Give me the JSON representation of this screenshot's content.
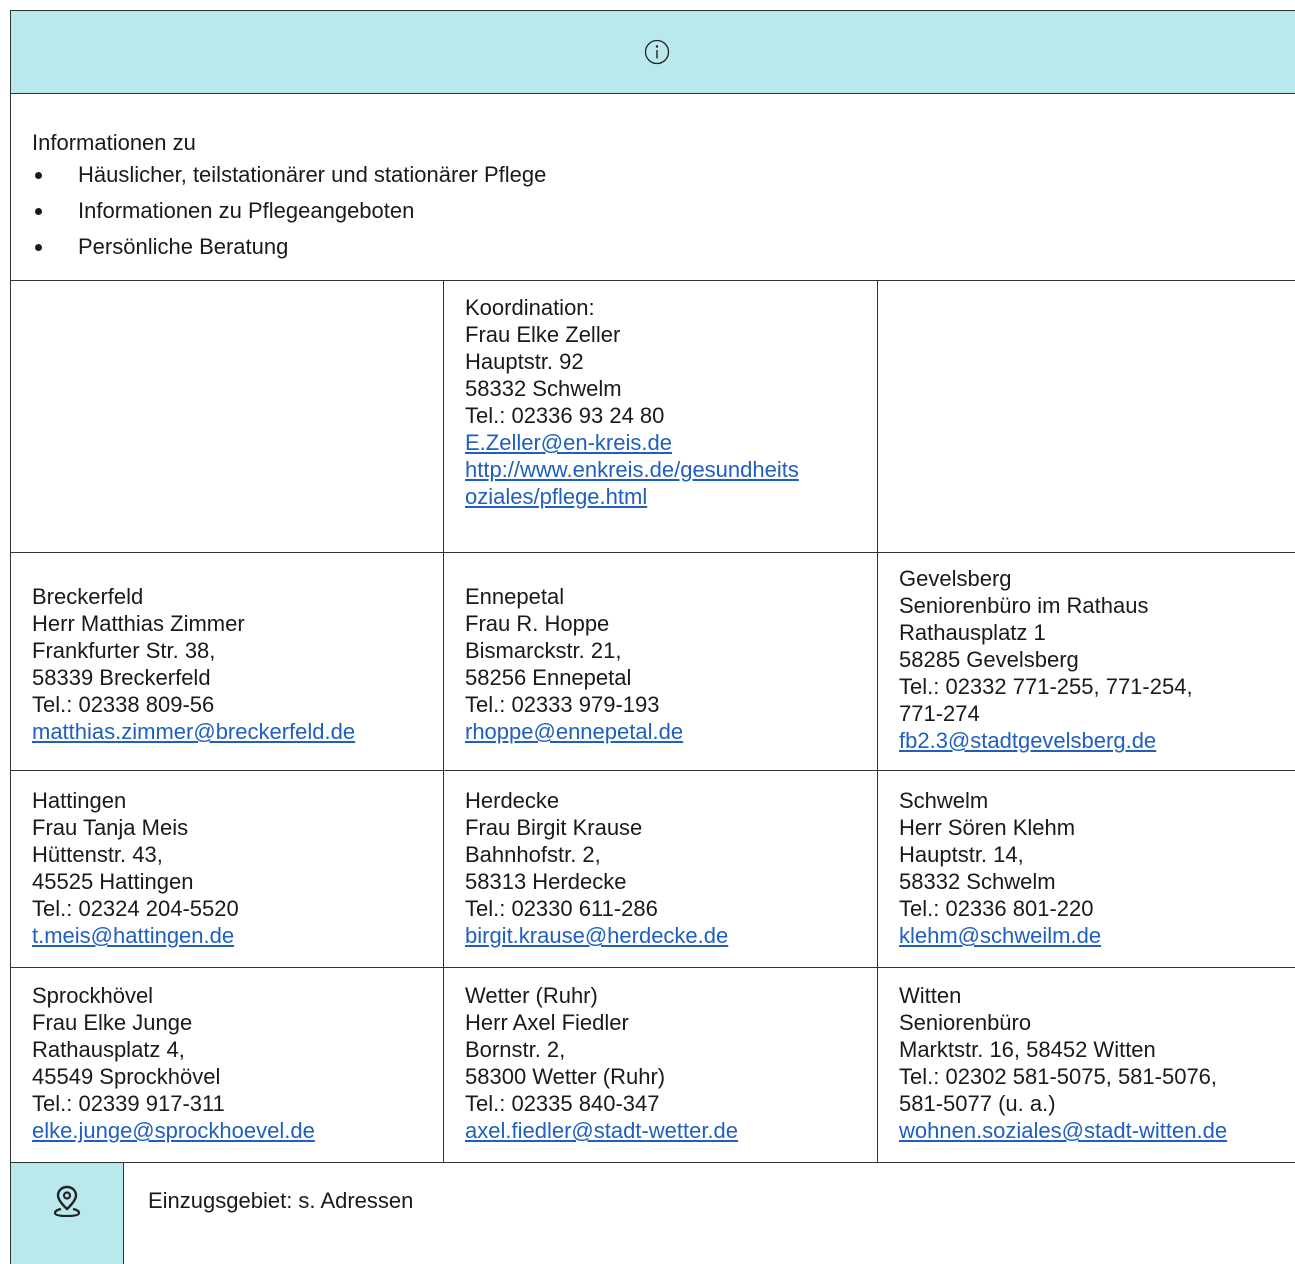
{
  "intro": {
    "title": "Informationen zu",
    "bullets": [
      "Häuslicher, teilstationärer und stationärer Pflege",
      "Informationen zu Pflegeangeboten",
      "Persönliche Beratung"
    ]
  },
  "coordination": {
    "lines": [
      "Koordination:",
      "Frau Elke Zeller",
      "Hauptstr. 92",
      "58332 Schwelm",
      "Tel.: 02336  93 24 80"
    ],
    "email": "E.Zeller@en-kreis.de",
    "url_line1": "http://www.enkreis.de/gesundheits",
    "url_line2": "oziales/pflege.html"
  },
  "contacts": [
    {
      "lines": [
        "Breckerfeld",
        "Herr Matthias Zimmer",
        "Frankfurter Str. 38,",
        "58339 Breckerfeld",
        "Tel.: 02338  809-56"
      ],
      "email": "matthias.zimmer@breckerfeld.de"
    },
    {
      "lines": [
        "Ennepetal",
        "Frau R. Hoppe",
        "Bismarckstr. 21,",
        "58256 Ennepetal",
        "Tel.: 02333  979-193"
      ],
      "email": "rhoppe@ennepetal.de"
    },
    {
      "lines": [
        "Gevelsberg",
        "Seniorenbüro im Rathaus",
        "Rathausplatz 1",
        "58285 Gevelsberg",
        "Tel.: 02332  771-255, 771-254,",
        "771-274"
      ],
      "email": "fb2.3@stadtgevelsberg.de"
    },
    {
      "lines": [
        "Hattingen",
        "Frau Tanja Meis",
        "Hüttenstr. 43,",
        "45525 Hattingen",
        "Tel.: 02324  204-5520"
      ],
      "email": "t.meis@hattingen.de"
    },
    {
      "lines": [
        "Herdecke",
        "Frau Birgit Krause",
        "Bahnhofstr. 2,",
        "58313 Herdecke",
        "Tel.: 02330  611-286"
      ],
      "email": "birgit.krause@herdecke.de"
    },
    {
      "lines": [
        "Schwelm",
        "Herr Sören Klehm",
        "Hauptstr. 14,",
        "58332 Schwelm",
        "Tel.: 02336  801-220"
      ],
      "email": "klehm@schweilm.de"
    },
    {
      "lines": [
        "Sprockhövel",
        "Frau Elke Junge",
        "Rathausplatz 4,",
        "45549 Sprockhövel",
        "Tel.: 02339  917-311"
      ],
      "email": "elke.junge@sprockhoevel.de"
    },
    {
      "lines": [
        "Wetter (Ruhr)",
        "Herr Axel Fiedler",
        "Bornstr. 2,",
        "58300 Wetter (Ruhr)",
        "Tel.: 02335  840-347"
      ],
      "email": "axel.fiedler@stadt-wetter.de"
    },
    {
      "lines": [
        "Witten",
        "Seniorenbüro",
        "Marktstr. 16, 58452 Witten",
        "Tel.: 02302  581-5075, 581-5076,",
        "581-5077 (u. a.)"
      ],
      "email": "wohnen.soziales@stadt-witten.de"
    }
  ],
  "footer": {
    "text": "Einzugsgebiet: s. Adressen"
  },
  "icons": {
    "header": "info-icon",
    "footer": "location-pin-icon"
  },
  "colors": {
    "header_bg": "#b9e9ec",
    "link": "#1f5fbf"
  }
}
